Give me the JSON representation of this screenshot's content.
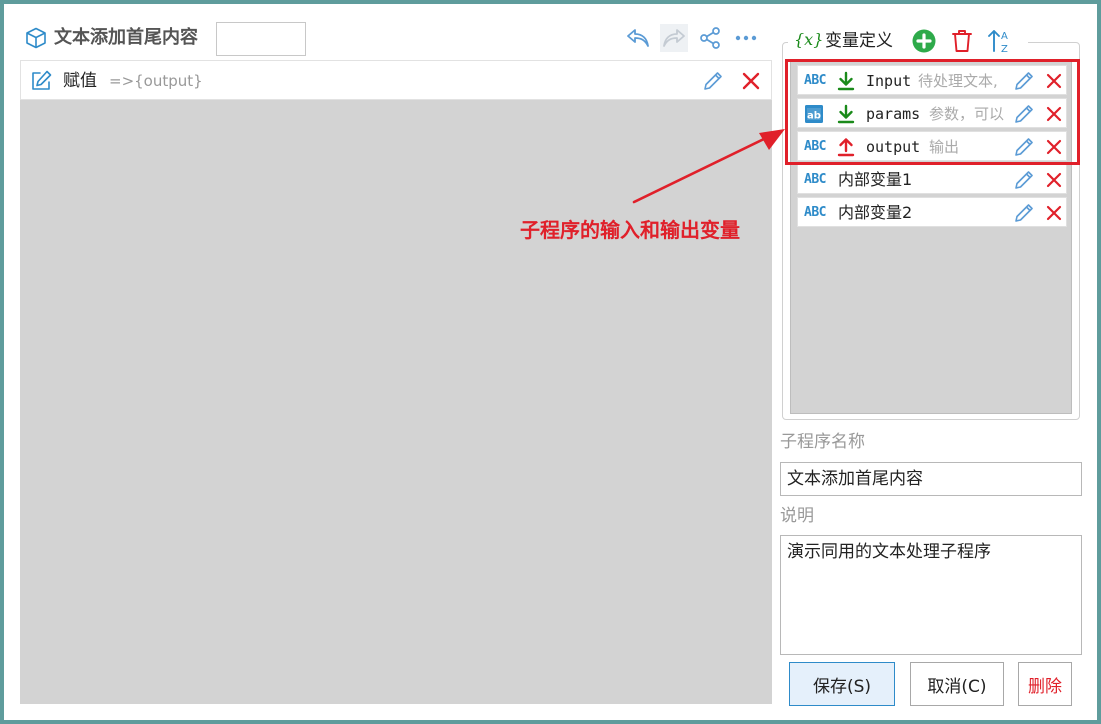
{
  "editor": {
    "title": "文本添加首尾内容",
    "title_input_value": "",
    "statement": {
      "label": "赋值",
      "arg": "=>{output}"
    }
  },
  "variables": {
    "fx_symbol": "{x}",
    "title": "变量定义",
    "items": [
      {
        "type": "ABC",
        "direction": "input",
        "name": "Input",
        "desc": "待处理文本,",
        "icon": "abc-type-icon"
      },
      {
        "type": "ab",
        "direction": "input",
        "name": "params",
        "desc": "参数，可以",
        "icon": "dictionary-type-icon"
      },
      {
        "type": "ABC",
        "direction": "output",
        "name": "output",
        "desc": "输出",
        "icon": "abc-type-icon"
      },
      {
        "type": "ABC",
        "direction": "",
        "name": "内部变量1",
        "desc": "",
        "icon": "abc-type-icon"
      },
      {
        "type": "ABC",
        "direction": "",
        "name": "内部变量2",
        "desc": "",
        "icon": "abc-type-icon"
      }
    ]
  },
  "annotation": {
    "text": "子程序的输入和输出变量"
  },
  "properties": {
    "name_label": "子程序名称",
    "name_value": "文本添加首尾内容",
    "desc_label": "说明",
    "desc_value": "演示同用的文本处理子程序"
  },
  "buttons": {
    "save": "保存(S)",
    "cancel": "取消(C)",
    "delete": "删除"
  },
  "colors": {
    "accent": "#2e8bc9",
    "danger": "#e0202a",
    "input_arrow": "#1a8a1a",
    "output_arrow": "#e0202a",
    "canvas": "#d3d3d3",
    "frame": "#5f9c9c"
  }
}
